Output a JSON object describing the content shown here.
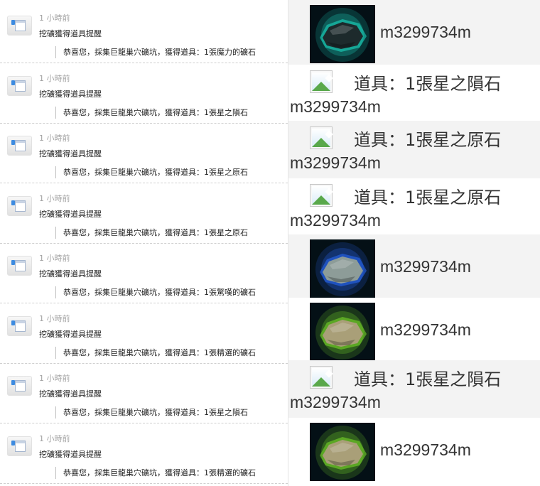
{
  "notifications": [
    {
      "time": "1 小時前",
      "title": "挖礦獲得道具提醒",
      "body": "恭喜您，採集巨龍巢穴礦坑，獲得道具：1張魔力的礦石"
    },
    {
      "time": "1 小時前",
      "title": "挖礦獲得道具提醒",
      "body": "恭喜您，採集巨龍巢穴礦坑，獲得道具：1張星之隕石"
    },
    {
      "time": "1 小時前",
      "title": "挖礦獲得道具提醒",
      "body": "恭喜您，採集巨龍巢穴礦坑，獲得道具：1張星之原石"
    },
    {
      "time": "1 小時前",
      "title": "挖礦獲得道具提醒",
      "body": "恭喜您，採集巨龍巢穴礦坑，獲得道具：1張星之原石"
    },
    {
      "time": "1 小時前",
      "title": "挖礦獲得道具提醒",
      "body": "恭喜您，採集巨龍巢穴礦坑，獲得道具：1張驚嘆的礦石"
    },
    {
      "time": "1 小時前",
      "title": "挖礦獲得道具提醒",
      "body": "恭喜您，採集巨龍巢穴礦坑，獲得道具：1張精選的礦石"
    },
    {
      "time": "1 小時前",
      "title": "挖礦獲得道具提醒",
      "body": "恭喜您，採集巨龍巢穴礦坑，獲得道具：1張星之隕石"
    },
    {
      "time": "1 小時前",
      "title": "挖礦獲得道具提醒",
      "body": "恭喜您，採集巨龍巢穴礦坑，獲得道具：1張精選的礦石"
    }
  ],
  "rewards": [
    {
      "kind": "image",
      "image": "dark-teal-ore-icon",
      "glow": "#1ee0c8",
      "rock": "#1d2a2c",
      "user": "m3299734m"
    },
    {
      "kind": "broken",
      "image": "broken-image-icon",
      "text": "道具：1張星之隕石",
      "user": "m3299734m"
    },
    {
      "kind": "broken",
      "image": "broken-image-icon",
      "text": "道具：1張星之原石",
      "user": "m3299734m"
    },
    {
      "kind": "broken",
      "image": "broken-image-icon",
      "text": "道具：1張星之原石",
      "user": "m3299734m"
    },
    {
      "kind": "image",
      "image": "blue-glow-ore-icon",
      "glow": "#2a6cff",
      "rock": "#8d9c98",
      "user": "m3299734m"
    },
    {
      "kind": "image",
      "image": "green-glow-ore-icon",
      "glow": "#7de22a",
      "rock": "#a99f78",
      "user": "m3299734m"
    },
    {
      "kind": "broken",
      "image": "broken-image-icon",
      "text": "道具：1張星之隕石",
      "user": "m3299734m"
    },
    {
      "kind": "image",
      "image": "green-glow-ore-icon",
      "glow": "#7de22a",
      "rock": "#a99f78",
      "user": "m3299734m"
    }
  ]
}
